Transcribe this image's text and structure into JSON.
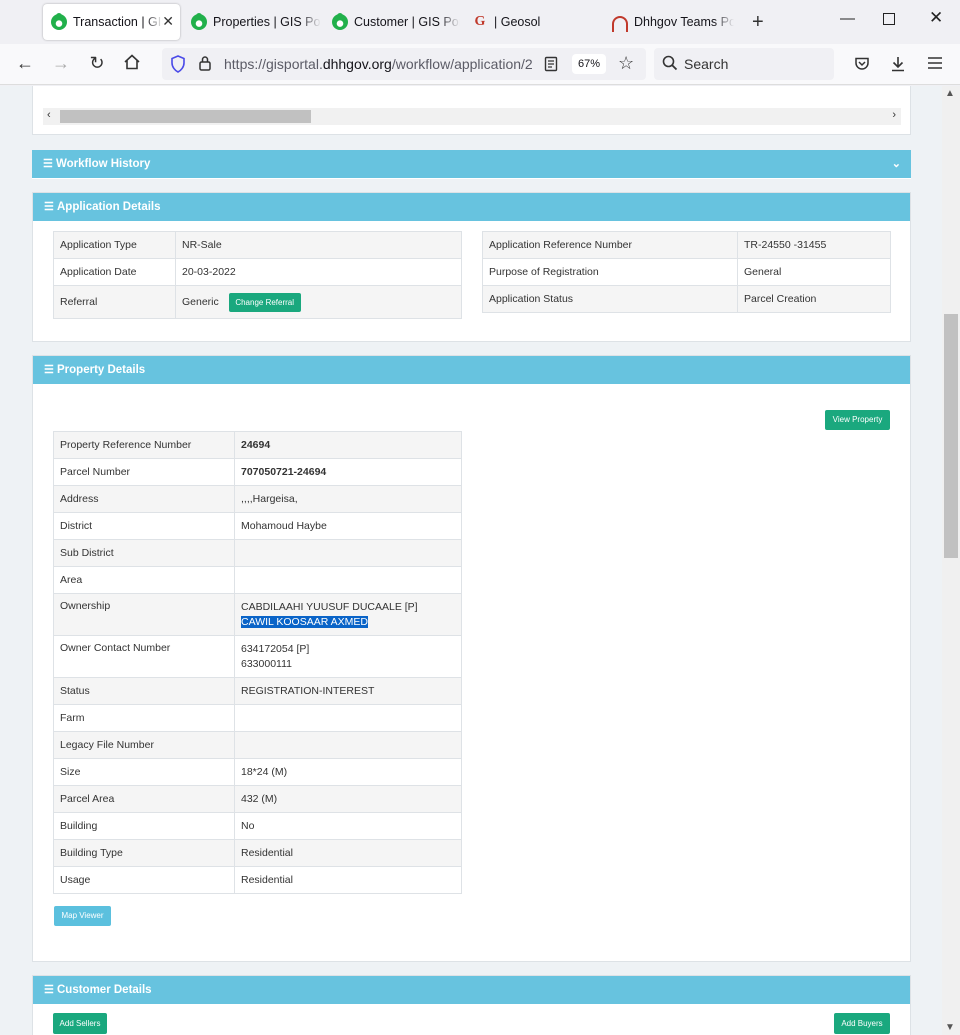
{
  "browser": {
    "tabs": [
      {
        "label": "Transaction | GIS Portal",
        "icon": "gis-logo-icon",
        "active": true
      },
      {
        "label": "Properties | GIS Portal",
        "icon": "gis-logo-icon"
      },
      {
        "label": "Customer | GIS Portal",
        "icon": "gis-logo-icon"
      },
      {
        "label": "| Geosol",
        "icon": "geosol-g-icon"
      },
      {
        "label": "Dhhgov Teams Portal",
        "icon": "teams-arc-icon"
      }
    ],
    "url_prefix": "https://gisportal.",
    "url_domain": "dhhgov.org",
    "url_path": "/workflow/application/2",
    "zoom": "67%",
    "search_placeholder": "Search"
  },
  "workflow_history": {
    "title": "Workflow History"
  },
  "application_details": {
    "title": "Application Details",
    "left": [
      {
        "label": "Application Type",
        "value": "NR-Sale"
      },
      {
        "label": "Application Date",
        "value": "20-03-2022"
      },
      {
        "label": "Referral",
        "value": "Generic",
        "button": "Change Referral"
      }
    ],
    "right": [
      {
        "label": "Application Reference Number",
        "value": "TR-24550 -31455"
      },
      {
        "label": "Purpose of Registration",
        "value": "General"
      },
      {
        "label": "Application Status",
        "value": "Parcel Creation"
      }
    ]
  },
  "property_details": {
    "title": "Property Details",
    "view_button": "View Property",
    "map_button": "Map Viewer",
    "rows": [
      {
        "label": "Property Reference Number",
        "value": "24694",
        "bold": true
      },
      {
        "label": "Parcel Number",
        "value": "707050721-24694",
        "bold": true
      },
      {
        "label": "Address",
        "value": ",,,,Hargeisa,"
      },
      {
        "label": "District",
        "value": "Mohamoud Haybe"
      },
      {
        "label": "Sub District",
        "value": ""
      },
      {
        "label": "Area",
        "value": ""
      },
      {
        "label": "Ownership",
        "value": "CABDILAAHI YUUSUF DUCAALE [P]",
        "value2": "CAWIL KOOSAAR AXMED",
        "highlight2": true
      },
      {
        "label": "Owner Contact Number",
        "value": "634172054 [P]",
        "value2": "633000111"
      },
      {
        "label": "Status",
        "value": "REGISTRATION-INTEREST"
      },
      {
        "label": "Farm",
        "value": ""
      },
      {
        "label": "Legacy File Number",
        "value": ""
      },
      {
        "label": "Size",
        "value": "18*24 (M)"
      },
      {
        "label": "Parcel Area",
        "value": "432 (M)"
      },
      {
        "label": "Building",
        "value": "No"
      },
      {
        "label": "Building Type",
        "value": "Residential"
      },
      {
        "label": "Usage",
        "value": "Residential"
      }
    ]
  },
  "customer_details": {
    "title": "Customer Details",
    "add_sellers": "Add Sellers",
    "add_buyers": "Add Buyers"
  }
}
